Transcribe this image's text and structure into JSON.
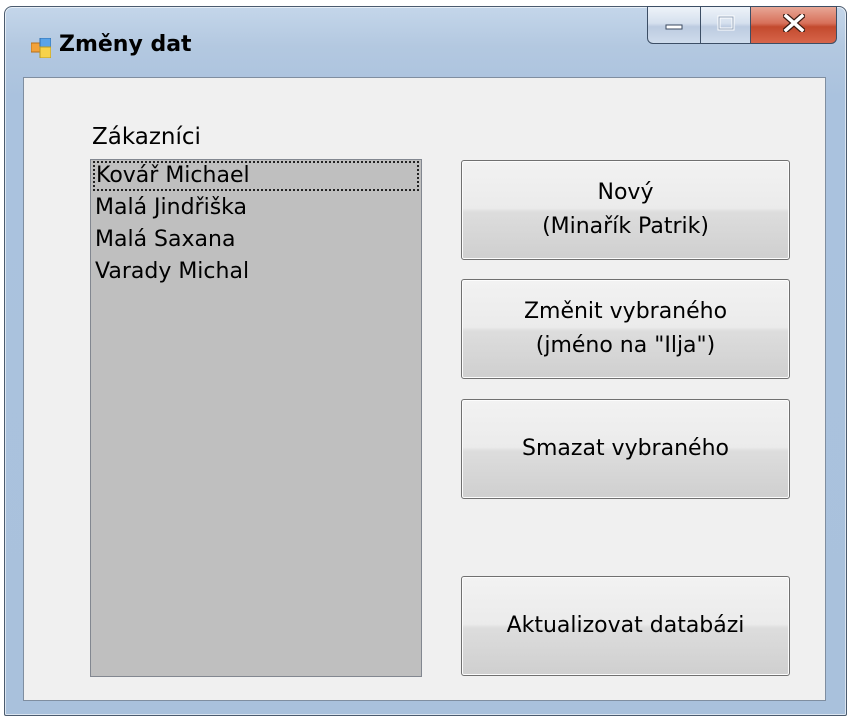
{
  "window": {
    "title": "Změny dat",
    "icon": "form-app-icon"
  },
  "caption_buttons": {
    "minimize_icon": "minimize-icon",
    "maximize_icon": "maximize-icon",
    "close_icon": "close-icon"
  },
  "customers": {
    "label": "Zákazníci",
    "items": [
      "Kovář Michael",
      "Malá Jindřiška",
      "Malá Saxana",
      "Varady Michal"
    ],
    "selected_index": 0
  },
  "buttons": {
    "new_line1": "Nový",
    "new_line2": "(Minařík Patrik)",
    "edit_line1": "Změnit vybraného",
    "edit_line2": "(jméno na \"Ilja\")",
    "delete": "Smazat vybraného",
    "update": "Aktualizovat databázi"
  },
  "colors": {
    "close_button": "#c9462c",
    "listbox_background": "#bfbfbf",
    "client_background": "#f0f0f0"
  }
}
